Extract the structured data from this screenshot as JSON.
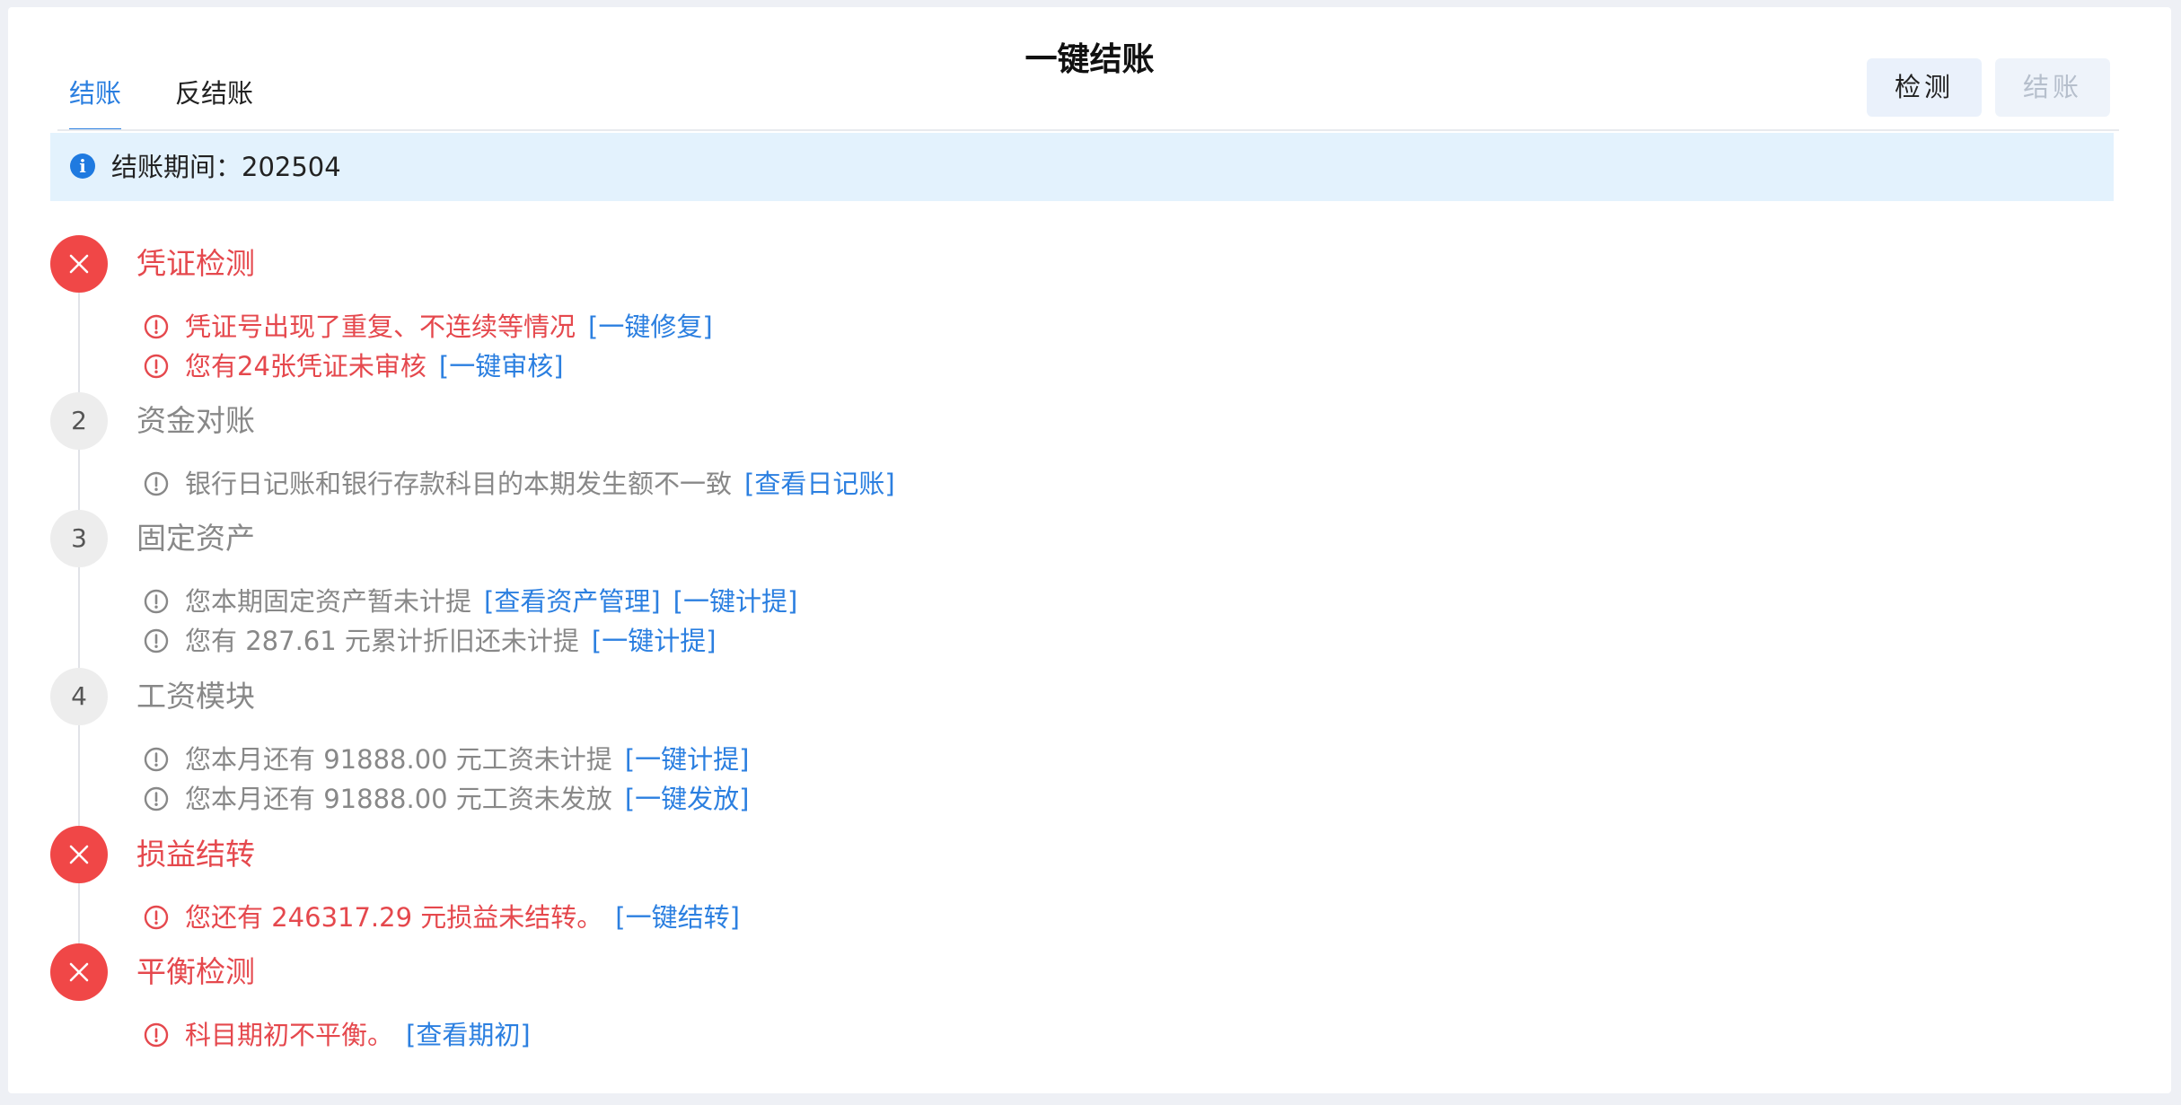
{
  "page": {
    "title": "一键结账"
  },
  "tabs": [
    {
      "label": "结账",
      "active": true
    },
    {
      "label": "反结账",
      "active": false
    }
  ],
  "buttons": {
    "detect": "检测",
    "close": "结账"
  },
  "info": {
    "text": "结账期间：202504",
    "icon": "info-icon",
    "color": "#1f7ae0"
  },
  "colors": {
    "error": "#e5484d",
    "link": "#2b7fe0",
    "muted": "#888888"
  },
  "steps": [
    {
      "marker": "close-icon",
      "status": "error",
      "title": "凭证检测",
      "items": [
        {
          "text": "凭证号出现了重复、不连续等情况",
          "links": [
            "[一键修复]"
          ]
        },
        {
          "text": "您有24张凭证未审核",
          "links": [
            "[一键审核]"
          ]
        }
      ]
    },
    {
      "marker": "2",
      "status": "warning",
      "title": "资金对账",
      "items": [
        {
          "text": "银行日记账和银行存款科目的本期发生额不一致",
          "links": [
            "[查看日记账]"
          ]
        }
      ]
    },
    {
      "marker": "3",
      "status": "warning",
      "title": "固定资产",
      "items": [
        {
          "text": "您本期固定资产暂未计提",
          "links": [
            "[查看资产管理]",
            "[一键计提]"
          ]
        },
        {
          "text": "您有 287.61 元累计折旧还未计提",
          "links": [
            "[一键计提]"
          ]
        }
      ]
    },
    {
      "marker": "4",
      "status": "warning",
      "title": "工资模块",
      "items": [
        {
          "text": "您本月还有 91888.00 元工资未计提",
          "links": [
            "[一键计提]"
          ]
        },
        {
          "text": "您本月还有 91888.00 元工资未发放",
          "links": [
            "[一键发放]"
          ]
        }
      ]
    },
    {
      "marker": "close-icon",
      "status": "error",
      "title": "损益结转",
      "items": [
        {
          "text": "您还有 246317.29 元损益未结转。",
          "links": [
            "[一键结转]"
          ]
        }
      ]
    },
    {
      "marker": "close-icon",
      "status": "error",
      "title": "平衡检测",
      "items": [
        {
          "text": "科目期初不平衡。",
          "links": [
            "[查看期初]"
          ]
        }
      ]
    }
  ]
}
